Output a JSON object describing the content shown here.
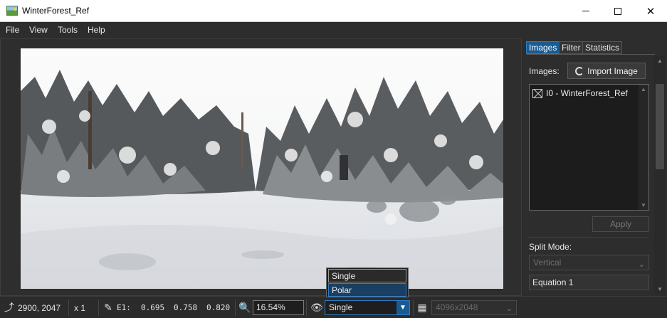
{
  "window": {
    "title": "WinterForest_Ref",
    "controls": {
      "minimize": "—",
      "maximize": "☐",
      "close": "✕"
    }
  },
  "menu": [
    "File",
    "View",
    "Tools",
    "Help"
  ],
  "viewport": {
    "image_subject": "snowy forest equirectangular panorama"
  },
  "sidepanel": {
    "tabs": [
      "Images",
      "Filter",
      "Statistics"
    ],
    "active_tab": "Images",
    "images_label": "Images:",
    "import_button": "Import Image",
    "list_items": [
      "I0 - WinterForest_Ref"
    ],
    "apply_button": "Apply",
    "split_mode_label": "Split Mode:",
    "split_mode_value": "Vertical",
    "equation": "Equation 1"
  },
  "statusbar": {
    "coords": "2900, 2047",
    "scale": "x 1",
    "eyedropper_label": "E1:",
    "pixel_values": [
      "0.695",
      "0.758",
      "0.820"
    ],
    "zoom": "16.54%",
    "view_mode": "Single",
    "resolution": "4096x2048"
  },
  "dropdown": {
    "options": [
      "Single",
      "Polar"
    ],
    "selected": "Single",
    "highlighted": "Polar"
  },
  "colors": {
    "accent": "#1a5b94",
    "accent_border": "#2f7cc4",
    "background": "#2b2b2b"
  }
}
